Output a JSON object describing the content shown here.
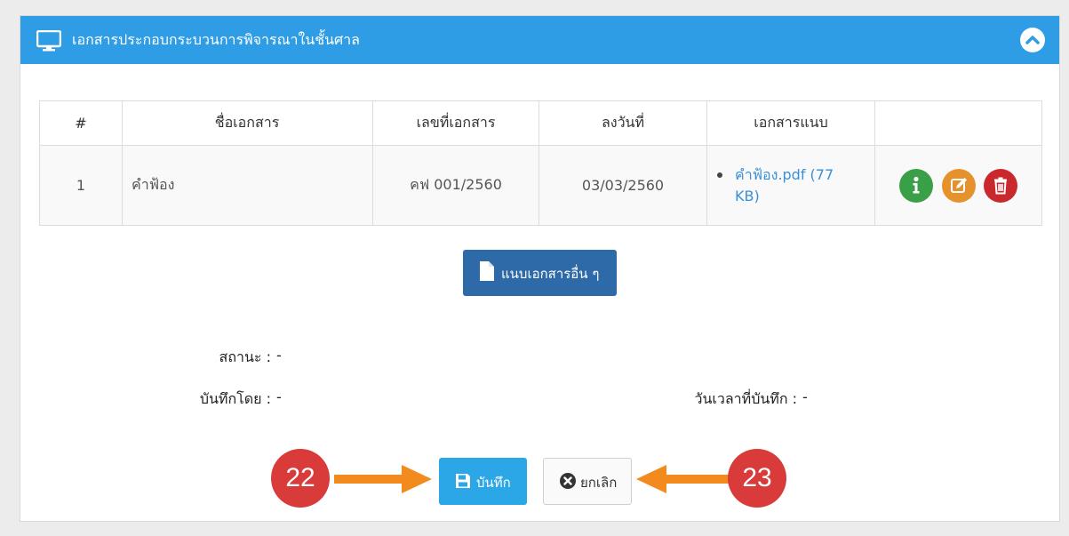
{
  "panel": {
    "title": "เอกสารประกอบกระบวนการพิจารณาในชั้นศาล",
    "header_color": "#2e9de6"
  },
  "table": {
    "headers": [
      "#",
      "ชื่อเอกสาร",
      "เลขที่เอกสาร",
      "ลงวันที่",
      "เอกสารแนบ",
      ""
    ],
    "rows": [
      {
        "num": "1",
        "name": "คำฟ้อง",
        "doc_no": "คฟ 001/2560",
        "date": "03/03/2560",
        "attachment": "คำฟ้อง.pdf (77 KB)"
      }
    ]
  },
  "icons": {
    "info": "info-icon",
    "edit": "edit-icon",
    "delete": "trash-icon",
    "file": "file-icon",
    "save": "floppy-disk-icon",
    "cancel": "cancel-circle-icon",
    "collapse": "chevron-up-icon",
    "monitor": "monitor-icon"
  },
  "buttons": {
    "attach_other": "แนบเอกสารอื่น ๆ",
    "save": "บันทึก",
    "cancel": "ยกเลิก"
  },
  "meta": {
    "status_label": "สถานะ :",
    "status_value": "-",
    "saved_by_label": "บันทึกโดย :",
    "saved_by_value": "-",
    "saved_at_label": "วันเวลาที่บันทึก :",
    "saved_at_value": "-"
  },
  "annotations": {
    "save_step": "22",
    "cancel_step": "23",
    "badge_color": "#d93a3a",
    "arrow_color": "#f28a1e"
  }
}
